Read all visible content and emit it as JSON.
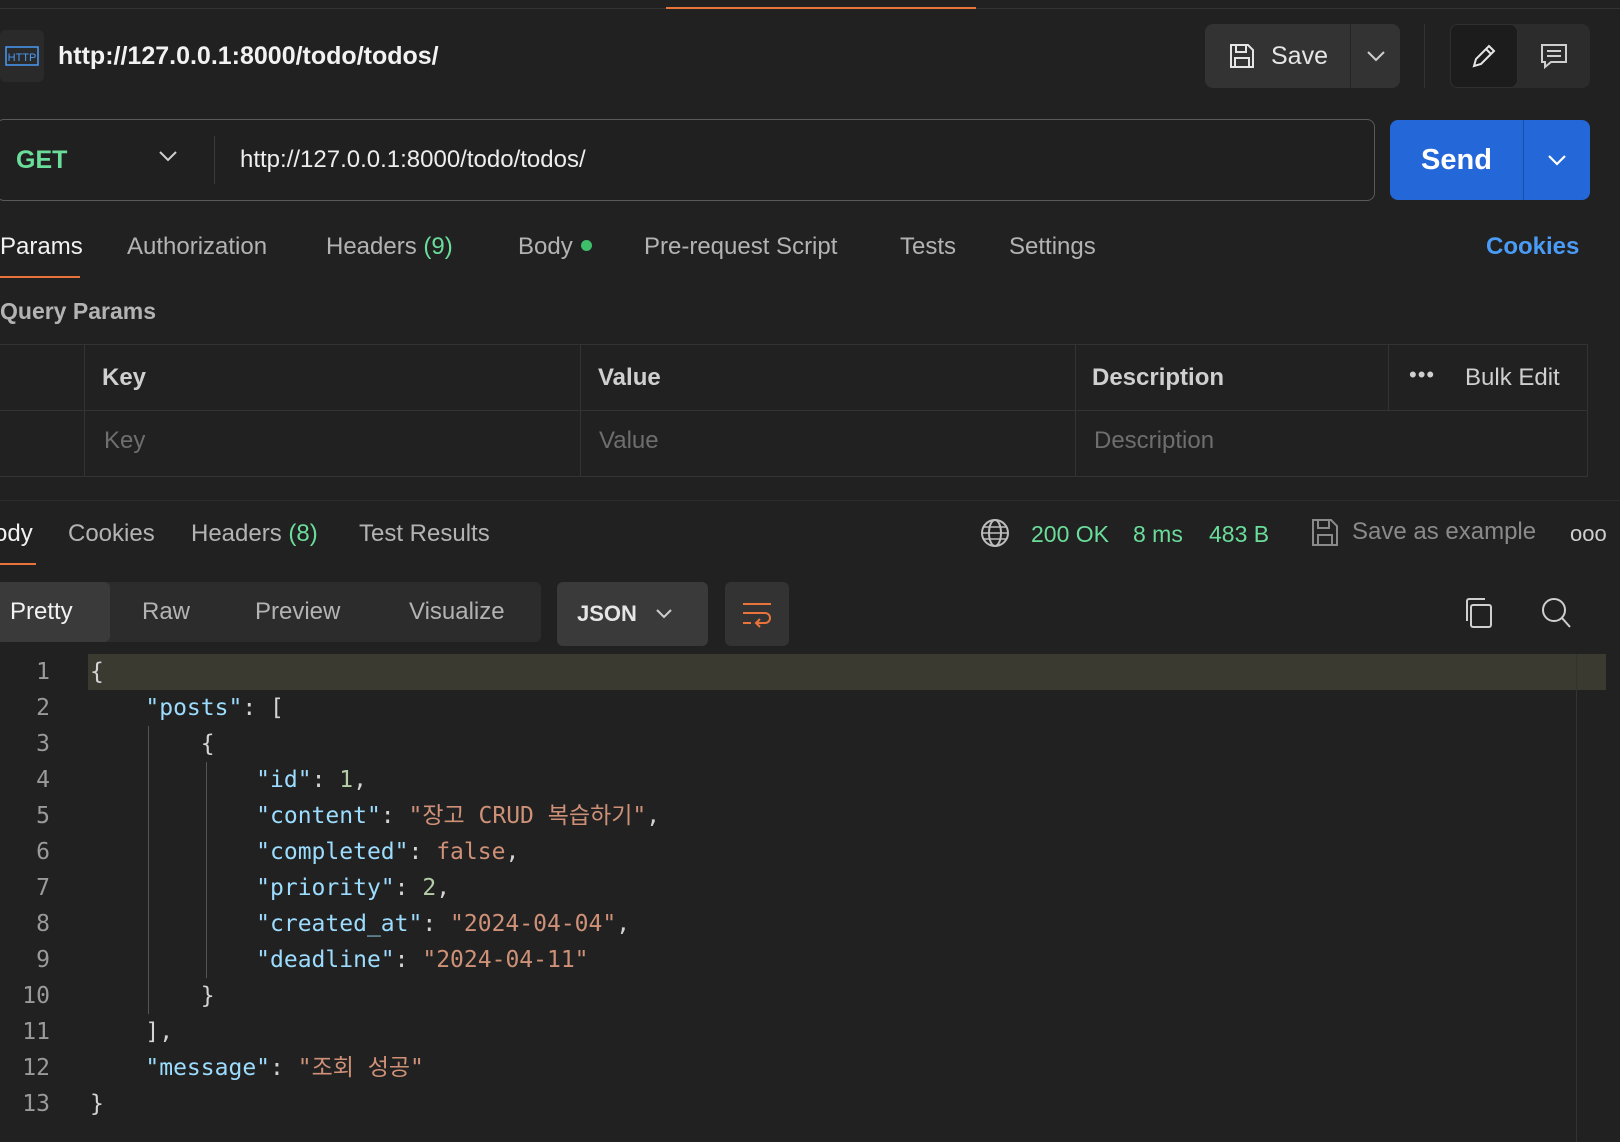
{
  "request": {
    "title": "http://127.0.0.1:8000/todo/todos/",
    "icon": "http-icon",
    "save_label": "Save",
    "method": "GET",
    "url": "http://127.0.0.1:8000/todo/todos/",
    "send_label": "Send"
  },
  "request_tabs": {
    "params": "Params",
    "authorization": "Authorization",
    "headers": "Headers",
    "headers_count": "(9)",
    "body": "Body",
    "prerequest": "Pre-request Script",
    "tests": "Tests",
    "settings": "Settings",
    "cookies": "Cookies"
  },
  "query_params": {
    "title": "Query Params",
    "headers": {
      "key": "Key",
      "value": "Value",
      "description": "Description",
      "bulk_edit": "Bulk Edit",
      "more": "•••"
    },
    "placeholders": {
      "key": "Key",
      "value": "Value",
      "description": "Description"
    }
  },
  "response": {
    "tabs": {
      "body": "Body",
      "cookies": "Cookies",
      "headers": "Headers",
      "headers_count": "(8)",
      "test_results": "Test Results"
    },
    "status": "200 OK",
    "time": "8 ms",
    "size": "483 B",
    "save_example": "Save as example",
    "more": "ooo",
    "views": {
      "pretty": "Pretty",
      "raw": "Raw",
      "preview": "Preview",
      "visualize": "Visualize"
    },
    "format": "JSON"
  },
  "code": {
    "line_numbers": [
      "1",
      "2",
      "3",
      "4",
      "5",
      "6",
      "7",
      "8",
      "9",
      "10",
      "11",
      "12",
      "13"
    ],
    "id_value": "1",
    "content_value": "\"장고 CRUD 복습하기\"",
    "completed_value": "false",
    "priority_value": "2",
    "created_at_value": "\"2024-04-04\"",
    "deadline_value": "\"2024-04-11\"",
    "message_value": "\"조회 성공\""
  },
  "colors": {
    "accent_orange": "#e8743b",
    "send_blue": "#2467d8",
    "status_green": "#6bdd9a",
    "link_blue": "#4a9bf5"
  }
}
